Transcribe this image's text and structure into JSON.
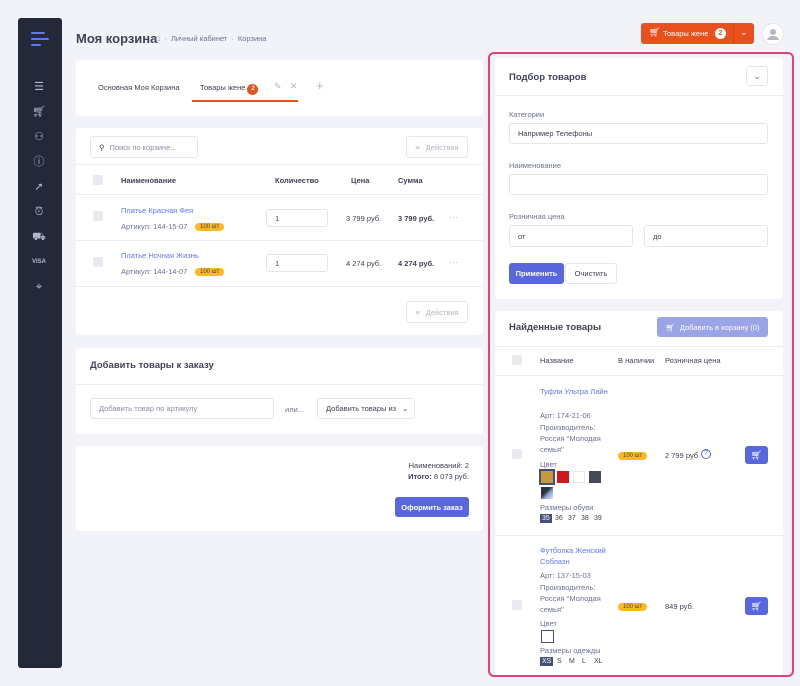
{
  "header": {
    "title": "Моя корзина",
    "breadcrumbs": [
      "Личный кабинет",
      "Корзина"
    ],
    "cart_button": {
      "label": "Товары жене",
      "count": "2"
    }
  },
  "sidebar": {
    "icons": [
      "list-icon",
      "cart-icon",
      "user-plus-icon",
      "info-icon",
      "cursor-icon",
      "alarm-icon",
      "truck-icon",
      "visa-icon",
      "location-icon"
    ]
  },
  "tabs": {
    "items": [
      {
        "label": "Основная Моя Корзина"
      },
      {
        "label": "Товары жене",
        "badge": "2"
      }
    ]
  },
  "cart": {
    "search_placeholder": "Поиск по корзине...",
    "actions_label": "Действия",
    "columns": [
      "Наименование",
      "Количество",
      "Цена",
      "Сумма"
    ],
    "rows": [
      {
        "name": "Платье Красная Фея",
        "article": "Артикул: 144-15-07",
        "stock": "100 шт",
        "qty": "1",
        "price": "3 799 руб.",
        "sum": "3 799 руб.",
        "more": "···"
      },
      {
        "name": "Платье Ночная Жизнь",
        "article": "Артикул: 144-14-07",
        "stock": "100 шт",
        "qty": "1",
        "price": "4 274 руб.",
        "sum": "4 274 руб.",
        "more": "···"
      }
    ]
  },
  "add_items": {
    "title": "Добавить товары к заказу",
    "article_placeholder": "Добавить товар по артикулу",
    "or_label": "или...",
    "dropdown_label": "Добавить товары из"
  },
  "summary": {
    "items_count": "Наименований: 2",
    "total_label": "Итого:",
    "total_value": "8 073 руб.",
    "checkout_label": "Оформить заказ"
  },
  "filter": {
    "title": "Подбор товаров",
    "category_label": "Категории",
    "category_placeholder": "Например Телефоны",
    "name_label": "Наименование",
    "price_label": "Розничная цена",
    "from_placeholder": "от",
    "to_placeholder": "до",
    "apply_label": "Применить",
    "clear_label": "Очистить"
  },
  "found": {
    "title": "Найденные товары",
    "add_button": "Добавить в корзину (0)",
    "columns": [
      "Название",
      "В наличии",
      "Розничная цена"
    ],
    "items": [
      {
        "name": "Туфли Ультра Лайн",
        "article": "Арт: 174-21-06",
        "maker": "Производитель: Россия \"Молодая семья\"",
        "color_label": "Цвет",
        "sizes_label": "Размеры обуви",
        "sizes": [
          "35",
          "36",
          "37",
          "38",
          "39"
        ],
        "stock": "100 шт",
        "price": "2 799 руб.",
        "help": "?"
      },
      {
        "name": "Футболка Женский Соблазн",
        "article": "Арт: 137-15-03",
        "maker": "Производитель: Россия \"Молодая семья\"",
        "color_label": "Цвет",
        "sizes_label": "Размеры одежды",
        "sizes": [
          "XS",
          "S",
          "M",
          "L",
          "XL"
        ],
        "stock": "100 шт",
        "price": "849 руб."
      }
    ]
  },
  "colors": {
    "accent": "#5867dd",
    "orange": "#e8501d",
    "highlight": "#e0427a",
    "badge": "#ffb822",
    "sidebar": "#242939"
  }
}
